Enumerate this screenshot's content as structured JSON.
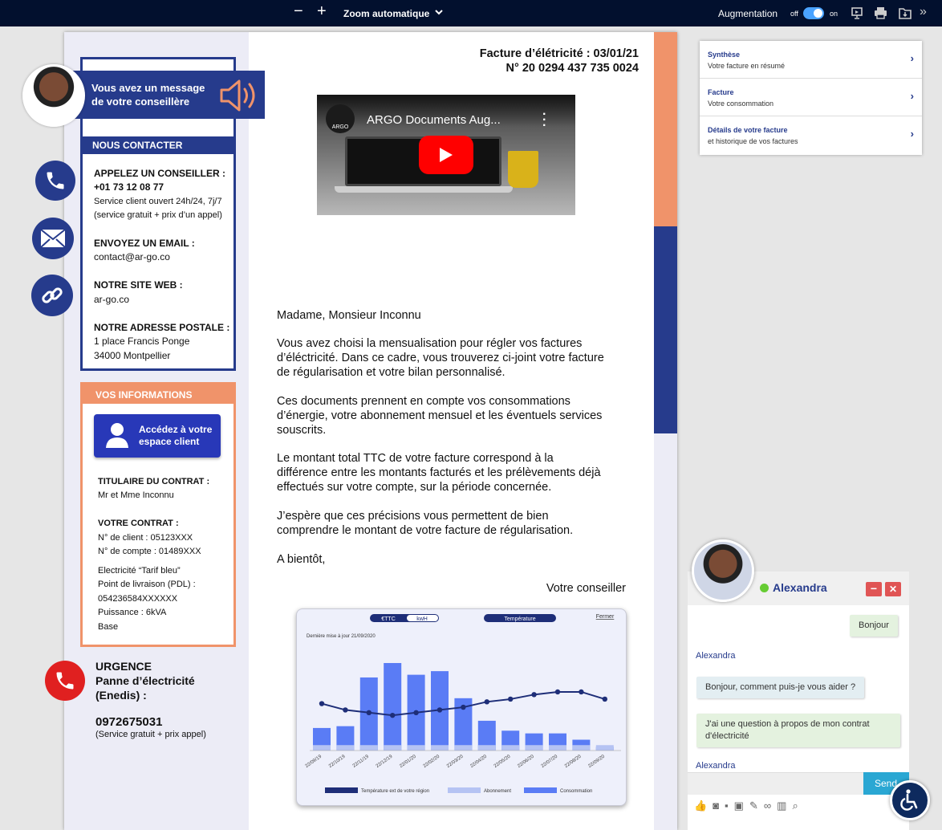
{
  "toolbar": {
    "zoom_label": "Zoom automatique",
    "augment_label": "Augmentation",
    "off_label": "off",
    "on_label": "on"
  },
  "header": {
    "invoice_title": "Facture d’élétricité : 03/01/21",
    "invoice_number": "N° 20 0294 437 735 0024"
  },
  "video": {
    "title": "ARGO Documents Aug...",
    "brand": "ARGO"
  },
  "message": {
    "line1": "Vous avez un message",
    "line2": "de votre conseillère"
  },
  "contact": {
    "header": "NOUS CONTACTER",
    "phone_title": "APPELEZ UN CONSEILLER :",
    "phone_number": "+01 73 12 08 77",
    "phone_note1": "Service client ouvert 24h/24, 7j/7",
    "phone_note2": "(service gratuit + prix d’un appel)",
    "email_title": "ENVOYEZ UN EMAIL :",
    "email": "contact@ar-go.co",
    "web_title": "NOTRE SITE WEB :",
    "web": "ar-go.co",
    "addr_title": "NOTRE ADRESSE POSTALE :",
    "addr1": "1 place Francis Ponge",
    "addr2": "34000 Montpellier"
  },
  "info": {
    "header": "VOS INFORMATIONS",
    "espace_line1": "Accédez à votre",
    "espace_line2": "espace client",
    "holder_title": "TITULAIRE DU CONTRAT :",
    "holder": "Mr et Mme Inconnu",
    "contract_title": "VOTRE CONTRAT :",
    "client_no": "N° de client : 05123XXX",
    "account_no": "N° de compte : 01489XXX",
    "tarif": "Electricité “Tarif bleu”",
    "pdl_label": "Point de livraison (PDL) :",
    "pdl": "054236584XXXXXX",
    "power": "Puissance : 6kVA",
    "option": "Base"
  },
  "urgence": {
    "title": "URGENCE",
    "line1": "Panne d’électricité",
    "line2": "(Enedis) :",
    "number": "0972675031",
    "note": "(Service gratuit + prix appel)"
  },
  "letter": {
    "greeting": "Madame, Monsieur Inconnu",
    "p1_l1": "Vous avez choisi la mensualisation pour régler vos factures",
    "p1_l2": "d’éléctricité. Dans ce cadre, vous trouverez ci-joint votre facture",
    "p1_l3": "de régularisation et votre bilan personnalisé.",
    "p2_l1": "Ces documents prennent en compte vos consommations",
    "p2_l2": "d’énergie, votre abonnement mensuel et les éventuels services",
    "p2_l3": "souscrits.",
    "p3_l1": "Le montant total TTC de votre facture correspond à la",
    "p3_l2": "différence entre les montants facturés et les prélèvements déjà",
    "p3_l3": "effectués sur votre compte, sur la période concernée.",
    "p4_l1": "J’espère que ces précisions vous permettent de bien",
    "p4_l2": "comprendre le montant de votre facture de régularisation.",
    "closing": "A bientôt,",
    "signature": "Votre conseiller"
  },
  "chart_data": {
    "type": "bar",
    "tabs": {
      "ttc": "€TTC",
      "kwh": "kwH",
      "temp": "Température",
      "close": "Fermer"
    },
    "subtitle": "Dernière mise à jour 21/09/2020",
    "categories": [
      "22/09/19",
      "22/10/19",
      "22/11/19",
      "22/12/19",
      "22/01/20",
      "22/02/20",
      "22/03/20",
      "22/04/20",
      "22/05/20",
      "22/06/20",
      "22/07/20",
      "22/08/20",
      "22/09/20"
    ],
    "series": [
      {
        "name": "Consommation",
        "values": [
          25,
          27,
          81,
          97,
          84,
          88,
          58,
          33,
          22,
          19,
          19,
          12,
          4
        ]
      },
      {
        "name": "Abonnement",
        "values": [
          6,
          6,
          6,
          6,
          6,
          6,
          6,
          6,
          6,
          6,
          6,
          6,
          6
        ]
      },
      {
        "name": "Température ext de votre région",
        "values": [
          52,
          45,
          42,
          39,
          42,
          45,
          48,
          54,
          57,
          62,
          65,
          65,
          57
        ]
      }
    ],
    "ylim": [
      0,
      105
    ],
    "colors": {
      "consommation": "#5a7cf5",
      "abonnement": "#b5c3f3",
      "temperature": "#1e2e78"
    }
  },
  "menu": {
    "items": [
      {
        "title": "Synthèse",
        "sub": "Votre facture en résumé"
      },
      {
        "title": "Facture",
        "sub": "Votre consommation"
      },
      {
        "title": "Détails de votre facture",
        "sub": "et historique de vos factures"
      }
    ]
  },
  "chat": {
    "agent": "Alexandra",
    "msg_user1": "Bonjour",
    "agent_label1": "Alexandra",
    "msg_agent1": "Bonjour, comment puis-je vous aider ?",
    "msg_user2_l1": "J'ai une question à propos de mon contrat",
    "msg_user2_l2": "d'électricité",
    "agent_label2": "Alexandra",
    "send": "Send"
  }
}
